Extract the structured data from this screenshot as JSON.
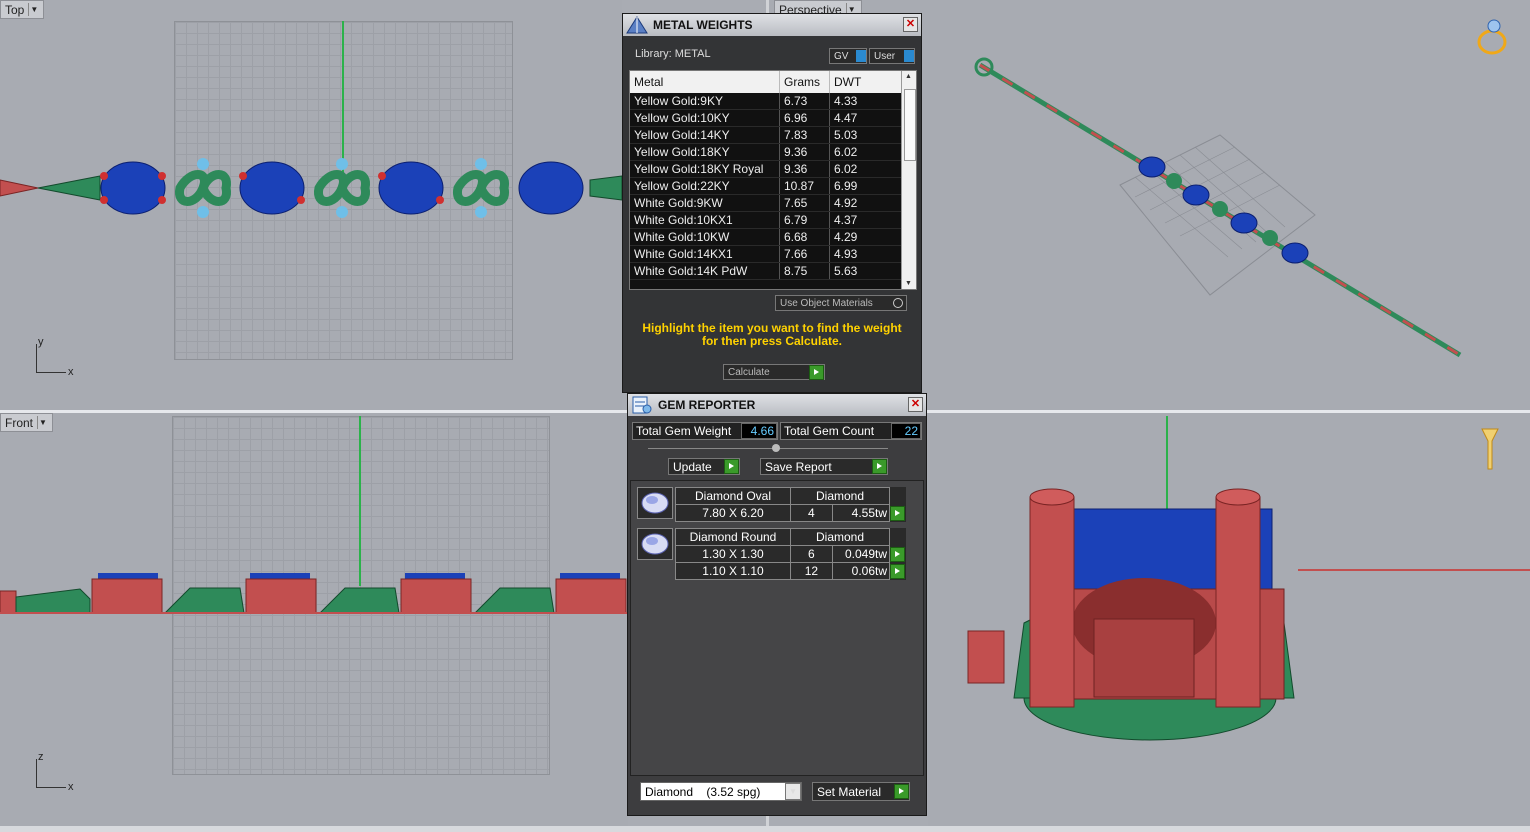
{
  "viewports": {
    "top": {
      "label": "Top",
      "axis_y": "y",
      "axis_x": "x"
    },
    "perspective": {
      "label": "Perspective"
    },
    "front": {
      "label": "Front",
      "axis_z": "z",
      "axis_x": "x"
    }
  },
  "metal_weights": {
    "title": "METAL WEIGHTS",
    "library": "Library: METAL",
    "gv_label": "GV",
    "user_label": "User",
    "columns": [
      "Metal",
      "Grams",
      "DWT"
    ],
    "rows": [
      {
        "metal": "Yellow Gold:9KY",
        "grams": "6.73",
        "dwt": "4.33"
      },
      {
        "metal": "Yellow Gold:10KY",
        "grams": "6.96",
        "dwt": "4.47"
      },
      {
        "metal": "Yellow Gold:14KY",
        "grams": "7.83",
        "dwt": "5.03"
      },
      {
        "metal": "Yellow Gold:18KY",
        "grams": "9.36",
        "dwt": "6.02"
      },
      {
        "metal": "Yellow Gold:18KY Royal",
        "grams": "9.36",
        "dwt": "6.02"
      },
      {
        "metal": "Yellow Gold:22KY",
        "grams": "10.87",
        "dwt": "6.99"
      },
      {
        "metal": "White Gold:9KW",
        "grams": "7.65",
        "dwt": "4.92"
      },
      {
        "metal": "White Gold:10KX1",
        "grams": "6.79",
        "dwt": "4.37"
      },
      {
        "metal": "White Gold:10KW",
        "grams": "6.68",
        "dwt": "4.29"
      },
      {
        "metal": "White Gold:14KX1",
        "grams": "7.66",
        "dwt": "4.93"
      },
      {
        "metal": "White Gold:14K PdW",
        "grams": "8.75",
        "dwt": "5.63"
      }
    ],
    "use_object_materials": "Use Object Materials",
    "hint": "Highlight the item you want to find the weight for then press Calculate.",
    "calculate": "Calculate"
  },
  "gem_reporter": {
    "title": "GEM REPORTER",
    "total_weight_label": "Total Gem Weight",
    "total_weight": "4.66",
    "total_count_label": "Total Gem Count",
    "total_count": "22",
    "update": "Update",
    "save_report": "Save Report",
    "groups": [
      {
        "name": "Diamond Oval",
        "material": "Diamond",
        "rows": [
          {
            "size": "7.80 X 6.20",
            "count": "4",
            "weight": "4.55tw"
          }
        ]
      },
      {
        "name": "Diamond Round",
        "material": "Diamond",
        "rows": [
          {
            "size": "1.30 X 1.30",
            "count": "6",
            "weight": "0.049tw"
          },
          {
            "size": "1.10 X 1.10",
            "count": "12",
            "weight": "0.06tw"
          }
        ]
      }
    ],
    "material_select": "Diamond    (3.52 spg)",
    "set_material": "Set Material"
  },
  "colors": {
    "accent_yellow": "#ffd200",
    "gem_blue": "#1a3fb0",
    "metal_green": "#2e8a5a",
    "prong_red": "#b84848"
  }
}
